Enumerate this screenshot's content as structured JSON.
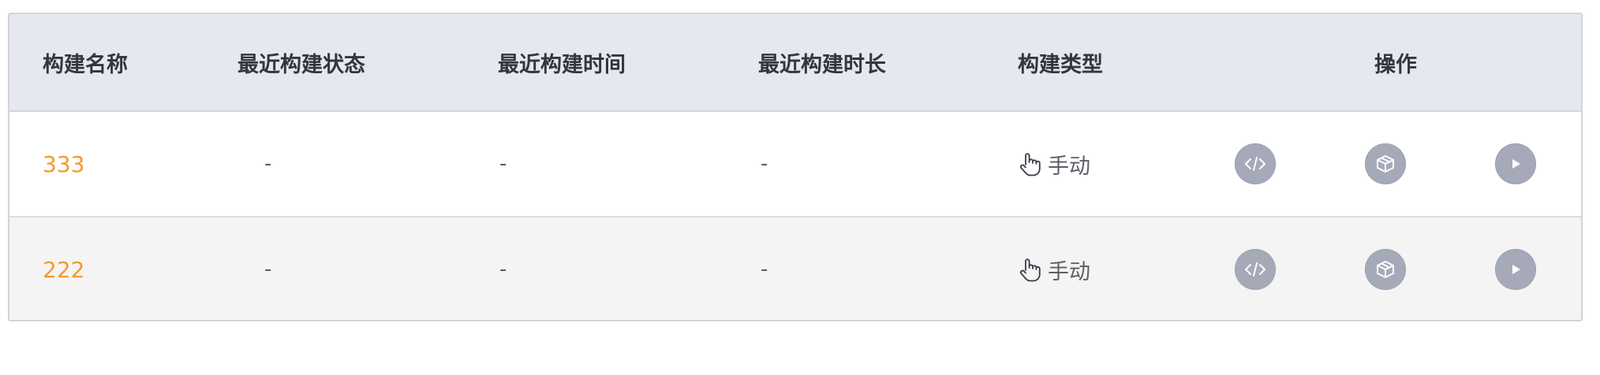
{
  "table": {
    "headers": {
      "name": "构建名称",
      "status": "最近构建状态",
      "time": "最近构建时间",
      "duration": "最近构建时长",
      "type": "构建类型",
      "ops": "操作"
    },
    "rows": [
      {
        "name": "333",
        "status": "-",
        "time": "-",
        "duration": "-",
        "type": "手动",
        "type_icon": "hand-pointer-icon",
        "actions": [
          "code-icon",
          "package-icon",
          "play-icon"
        ]
      },
      {
        "name": "222",
        "status": "-",
        "time": "-",
        "duration": "-",
        "type": "手动",
        "type_icon": "hand-pointer-icon",
        "actions": [
          "code-icon",
          "package-icon",
          "play-icon"
        ]
      }
    ]
  },
  "colors": {
    "header_bg": "#e6e8f0",
    "link": "#f29a2e",
    "action_button": "#a6aab8",
    "row_alt_bg": "#f4f4f5"
  }
}
